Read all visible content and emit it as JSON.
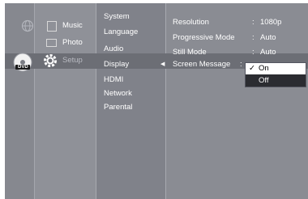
{
  "media_menu": {
    "items": [
      {
        "label": "Music",
        "icon": "music-icon"
      },
      {
        "label": "Photo",
        "icon": "photo-icon"
      },
      {
        "label": "Setup",
        "icon": "gear-icon"
      }
    ]
  },
  "side_icons": {
    "top": "globe-icon",
    "disc": "dvd-disc-icon",
    "disc_label": "DVD"
  },
  "categories": {
    "items": [
      "System",
      "Language",
      "Audio",
      "Display",
      "HDMI",
      "Network",
      "Parental"
    ],
    "selected": "Display"
  },
  "settings": {
    "rows": [
      {
        "label": "Resolution",
        "value": "1080p"
      },
      {
        "label": "Progressive Mode",
        "value": "Auto"
      },
      {
        "label": "Still Mode",
        "value": "Auto"
      },
      {
        "label": "Screen Message",
        "value": ""
      }
    ],
    "separator": ":"
  },
  "popup": {
    "options": [
      "On",
      "Off"
    ],
    "selected": "On",
    "check": "✓"
  },
  "colors": {
    "background": "#7b7d84",
    "selection": "#6c6e75",
    "popup_bg": "#2b2c31"
  }
}
